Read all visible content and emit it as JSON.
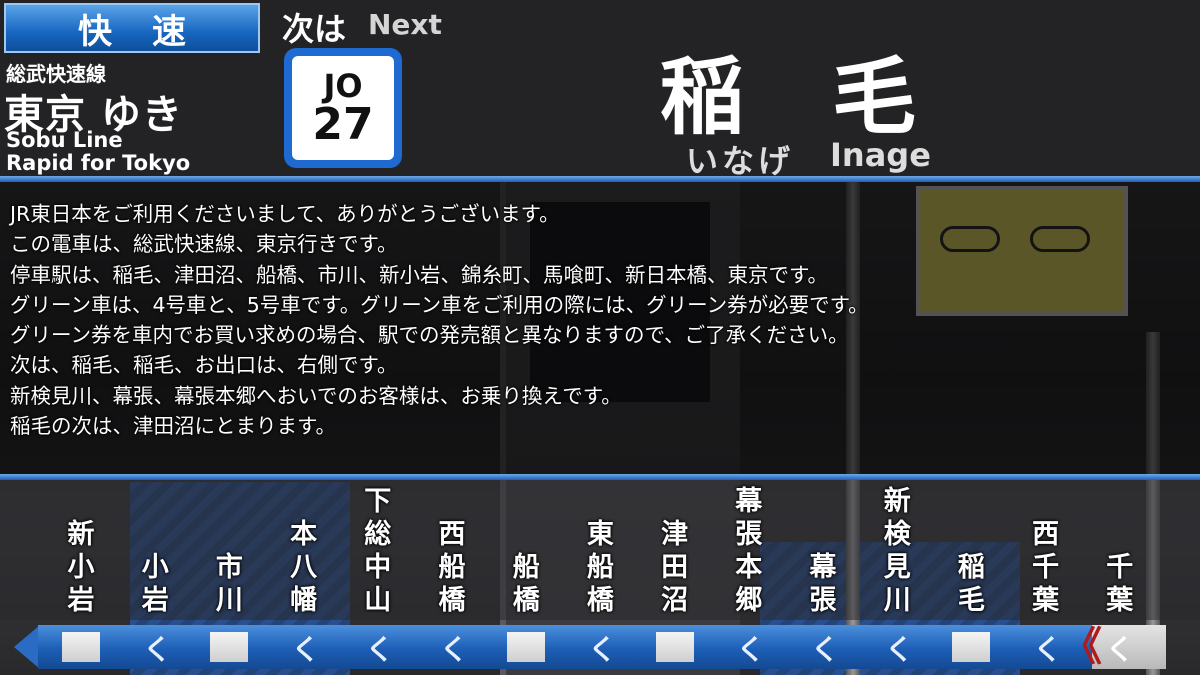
{
  "header": {
    "service_type": "快速",
    "line_ja": "総武快速線",
    "destination_ja": "東京 ゆき",
    "line_en": "Sobu Line",
    "destination_en": "Rapid for Tokyo",
    "next_label_ja": "次は",
    "next_label_en": "Next",
    "station_number_line": "JO",
    "station_number": "27",
    "next_station_ja": "稲毛",
    "next_station_kana": "いなげ",
    "next_station_en": "Inage"
  },
  "announcement": {
    "lines": [
      "JR東日本をご利用くださいまして、ありがとうございます。",
      "この電車は、総武快速線、東京行きです。",
      "停車駅は、稲毛、津田沼、船橋、市川、新小岩、錦糸町、馬喰町、新日本橋、東京です。",
      "グリーン車は、4号車と、5号車です。グリーン車をご利用の際には、グリーン券が必要です。",
      "グリーン券を車内でお買い求めの場合、駅での発売額と異なりますので、ご了承ください。",
      "次は、稲毛、稲毛、お出口は、右側です。",
      "新検見川、幕張、幕張本郷へおいでのお客様は、お乗り換えです。",
      "稲毛の次は、津田沼にとまります。"
    ]
  },
  "route": {
    "stations": [
      {
        "name": "新小岩",
        "stop": true
      },
      {
        "name": "小岩",
        "stop": false
      },
      {
        "name": "市川",
        "stop": true
      },
      {
        "name": "本八幡",
        "stop": false
      },
      {
        "name": "下総中山",
        "stop": false
      },
      {
        "name": "西船橋",
        "stop": false
      },
      {
        "name": "船橋",
        "stop": true
      },
      {
        "name": "東船橋",
        "stop": false
      },
      {
        "name": "津田沼",
        "stop": true
      },
      {
        "name": "幕張本郷",
        "stop": false
      },
      {
        "name": "幕張",
        "stop": false
      },
      {
        "name": "新検見川",
        "stop": false
      },
      {
        "name": "稲毛",
        "stop": true
      },
      {
        "name": "西千葉",
        "stop": false
      },
      {
        "name": "千葉",
        "stop": false
      }
    ],
    "direction_glyph": "く",
    "current_marker_glyph": "《"
  },
  "colors": {
    "line_blue": "#1d5eb6",
    "current_red": "#b01a1a"
  }
}
